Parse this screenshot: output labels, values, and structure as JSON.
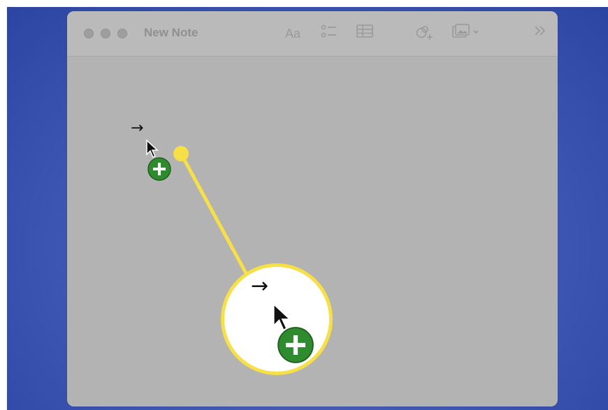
{
  "window": {
    "title": "New Note",
    "toolbar": {
      "format_label": "Aa",
      "sidebar_icon": "chevrons-right-icon"
    }
  },
  "cursor": {
    "arrow_glyph": "→",
    "icon": "copy-cursor-icon",
    "badge": "plus-badge-icon"
  },
  "colors": {
    "desktop": "#3f57b4",
    "highlight": "#f7e046",
    "badge_green": "#2e8b2e"
  }
}
